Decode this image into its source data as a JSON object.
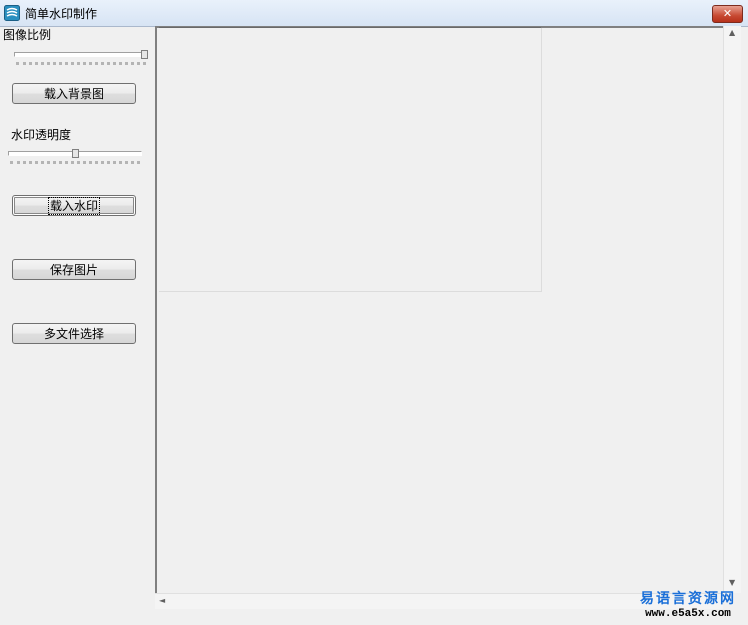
{
  "window": {
    "title": "简单水印制作",
    "close_label": "✕"
  },
  "sidebar": {
    "scale_label": "图像比例",
    "scale_slider_value": 1.0,
    "load_background_label": "载入背景图",
    "opacity_label": "水印透明度",
    "opacity_slider_value": 0.5,
    "load_watermark_label": "载入水印",
    "save_image_label": "保存图片",
    "multi_file_label": "多文件选择"
  },
  "scrollbars": {
    "up_arrow": "▲",
    "down_arrow": "▼",
    "left_arrow": "◄"
  },
  "watermark": {
    "site_name": "易语言资源网",
    "site_url": "www.e5a5x.com"
  }
}
